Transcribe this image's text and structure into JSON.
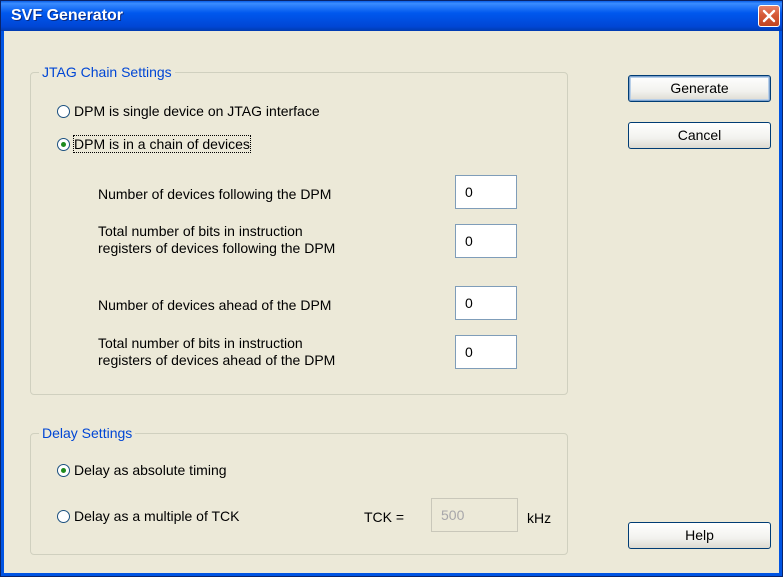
{
  "window": {
    "title": "SVF Generator"
  },
  "jtag": {
    "legend": "JTAG Chain Settings",
    "single_device_label": "DPM is single device on JTAG interface",
    "chain_label": "DPM is in a chain of devices",
    "selected": "chain",
    "devices_following_label": "Number of devices following the DPM",
    "devices_following_value": "0",
    "bits_following_label_line1": "Total number of bits in instruction",
    "bits_following_label_line2": "registers of devices following the DPM",
    "bits_following_value": "0",
    "devices_ahead_label": "Number of devices ahead of the DPM",
    "devices_ahead_value": "0",
    "bits_ahead_label_line1": "Total number of bits in instruction",
    "bits_ahead_label_line2": "registers of devices ahead of the DPM",
    "bits_ahead_value": "0"
  },
  "delay": {
    "legend": "Delay Settings",
    "absolute_label": "Delay as absolute timing",
    "multiple_label": "Delay as a multiple of TCK",
    "selected": "absolute",
    "tck_label": "TCK =",
    "tck_value": "500",
    "tck_unit": "kHz"
  },
  "buttons": {
    "generate": "Generate",
    "cancel": "Cancel",
    "help": "Help"
  },
  "icons": {
    "close": "close-icon"
  }
}
